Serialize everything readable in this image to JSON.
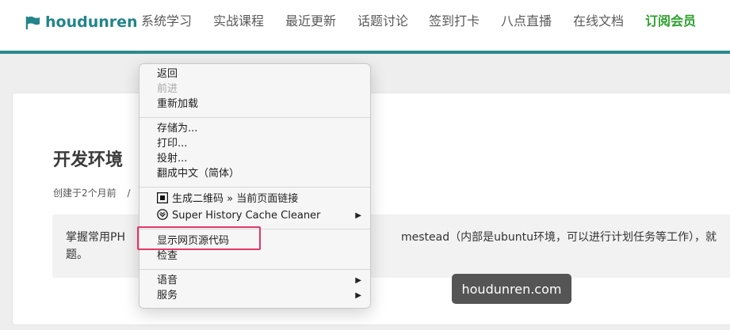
{
  "navbar": {
    "logo_text": "houdunren",
    "items": [
      {
        "label": "系统学习"
      },
      {
        "label": "实战课程"
      },
      {
        "label": "最近更新"
      },
      {
        "label": "话题讨论"
      },
      {
        "label": "签到打卡"
      },
      {
        "label": "八点直播"
      },
      {
        "label": "在线文档"
      },
      {
        "label": "订阅会员"
      }
    ],
    "accent_color": "#2c8a8d",
    "vip_color": "#2ba02b"
  },
  "article": {
    "title": "开发环境",
    "created": "创建于2个月前",
    "meta_sep": "/",
    "intro_left": "掌握常用PH",
    "intro_right": "mestead（内部是ubuntu环境，可以进行计划任务等工作），就",
    "intro_line2": "题。"
  },
  "context_menu": {
    "group1": [
      {
        "label": "返回",
        "enabled": true
      },
      {
        "label": "前进",
        "enabled": false
      },
      {
        "label": "重新加载",
        "enabled": true
      }
    ],
    "group2": [
      {
        "label": "存储为..."
      },
      {
        "label": "打印..."
      },
      {
        "label": "投射..."
      },
      {
        "label": "翻成中文（简体）"
      }
    ],
    "group3": [
      {
        "label": "生成二维码 » 当前页面链接",
        "icon": "qr-icon"
      },
      {
        "label": "Super History  Cache Cleaner",
        "icon": "extension-icon",
        "submenu": true
      }
    ],
    "group4": [
      {
        "label": "显示网页源代码"
      },
      {
        "label": "检查"
      }
    ],
    "group5": [
      {
        "label": "语音",
        "submenu": true
      },
      {
        "label": "服务",
        "submenu": true
      }
    ],
    "highlight_color": "#e0386a"
  },
  "tooltip": {
    "text": "houdunren.com"
  }
}
